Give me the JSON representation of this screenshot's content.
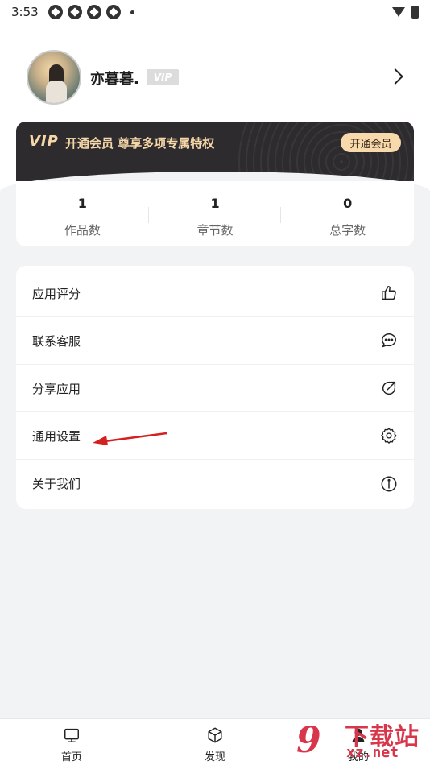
{
  "status_bar": {
    "time": "3:53"
  },
  "profile": {
    "username": "亦暮暮.",
    "vip_badge": "VIP"
  },
  "vip_banner": {
    "logo": "VIP",
    "text": "开通会员 尊享多项专属特权",
    "button_label": "开通会员",
    "accent_color": "#f6d7a8",
    "background_color": "#2e2b2f"
  },
  "stats": [
    {
      "value": "1",
      "label": "作品数"
    },
    {
      "value": "1",
      "label": "章节数"
    },
    {
      "value": "0",
      "label": "总字数"
    }
  ],
  "menu": [
    {
      "label": "应用评分",
      "icon": "thumbs-up-icon"
    },
    {
      "label": "联系客服",
      "icon": "chat-bubble-icon"
    },
    {
      "label": "分享应用",
      "icon": "share-icon"
    },
    {
      "label": "通用设置",
      "icon": "gear-icon"
    },
    {
      "label": "关于我们",
      "icon": "info-icon"
    }
  ],
  "tabs": [
    {
      "label": "首页",
      "icon": "monitor-icon"
    },
    {
      "label": "发现",
      "icon": "cube-icon"
    },
    {
      "label": "我的",
      "icon": "user-icon"
    }
  ],
  "watermark": {
    "line1": "下载站",
    "line2": "xz.net",
    "logo": "9"
  }
}
